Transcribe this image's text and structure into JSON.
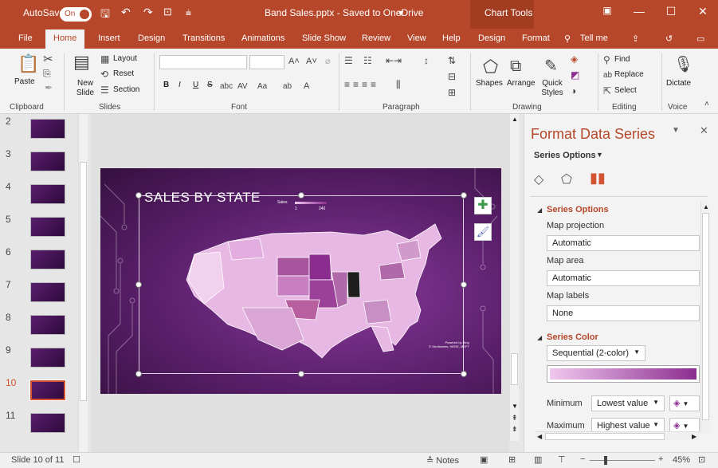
{
  "titlebar": {
    "autosave": "AutoSave",
    "autosave_state": "On",
    "filename": "Band Sales.pptx - Saved to OneDrive",
    "context": "Chart Tools"
  },
  "tabs": [
    "File",
    "Home",
    "Insert",
    "Design",
    "Transitions",
    "Animations",
    "Slide Show",
    "Review",
    "View",
    "Help",
    "Design",
    "Format"
  ],
  "tell_me": "Tell me",
  "ribbon": {
    "clipboard": {
      "paste": "Paste",
      "label": "Clipboard"
    },
    "slides": {
      "new_slide": "New Slide",
      "layout": "Layout",
      "reset": "Reset",
      "section": "Section",
      "label": "Slides"
    },
    "font": {
      "label": "Font",
      "bold": "B",
      "italic": "I",
      "underline": "U",
      "strike": "S"
    },
    "paragraph": {
      "label": "Paragraph"
    },
    "drawing": {
      "shapes": "Shapes",
      "arrange": "Arrange",
      "quick_styles": "Quick Styles",
      "label": "Drawing"
    },
    "editing": {
      "find": "Find",
      "replace": "Replace",
      "select": "Select",
      "label": "Editing"
    },
    "voice": {
      "dictate": "Dictate",
      "label": "Voice"
    }
  },
  "thumbs": [
    {
      "num": "2"
    },
    {
      "num": "3"
    },
    {
      "num": "4"
    },
    {
      "num": "5"
    },
    {
      "num": "6"
    },
    {
      "num": "7"
    },
    {
      "num": "8"
    },
    {
      "num": "9"
    },
    {
      "num": "10",
      "selected": true
    },
    {
      "num": "11"
    }
  ],
  "slide": {
    "title": "SALES BY STATE",
    "legend_title": "Sales",
    "legend_min": "1",
    "legend_max": "240",
    "attribution": "Powered by Bing\n© GeoNames, HERE, MSFT"
  },
  "pane": {
    "title": "Format Data Series",
    "options": "Series Options",
    "section1": "Series Options",
    "map_projection_label": "Map projection",
    "map_projection": "Automatic",
    "map_area_label": "Map area",
    "map_area": "Automatic",
    "map_labels_label": "Map labels",
    "map_labels": "None",
    "section2": "Series Color",
    "color_mode": "Sequential (2-color)",
    "minimum_label": "Minimum",
    "minimum_value": "Lowest value",
    "maximum_label": "Maximum",
    "maximum_value": "Highest value"
  },
  "status": {
    "slide": "Slide 10 of 11",
    "notes": "Notes",
    "zoom": "45%"
  },
  "colors": {
    "accent": "#b7472a",
    "min_color": "#f0c8ee",
    "max_color": "#8b2d8f"
  }
}
